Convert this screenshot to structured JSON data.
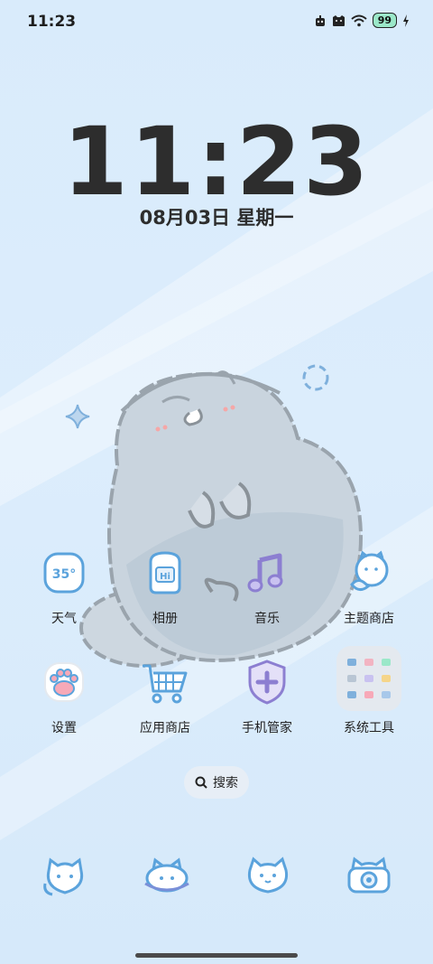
{
  "status_bar": {
    "time": "11:23",
    "battery": "99",
    "icons": [
      "robot-icon",
      "cat-face-icon",
      "wifi-icon",
      "battery-icon",
      "charging-icon"
    ]
  },
  "lock_clock": {
    "time": "11:23",
    "date": "08月03日 星期一"
  },
  "apps": [
    {
      "label": "天气",
      "icon_text": "35°",
      "icon": "weather-icon"
    },
    {
      "label": "相册",
      "icon_text": "Hi",
      "icon": "photo-album-icon"
    },
    {
      "label": "音乐",
      "icon": "music-note-icon"
    },
    {
      "label": "主题商店",
      "icon": "cat-theme-icon"
    },
    {
      "label": "设置",
      "icon": "paw-icon"
    },
    {
      "label": "应用商店",
      "icon": "shopping-cart-icon"
    },
    {
      "label": "手机管家",
      "icon": "shield-plus-icon"
    },
    {
      "label": "系统工具",
      "icon": "folder-icon"
    }
  ],
  "search": {
    "label": "搜索"
  },
  "dock": [
    "cat-phone-icon",
    "cat-message-icon",
    "cat-browser-icon",
    "cat-camera-icon"
  ],
  "colors": {
    "background": "#dcedfc",
    "text": "#2d2d2d",
    "icon_stroke": "#5ba3dc",
    "accent_pink": "#f7a9b8",
    "accent_purple": "#8c7fd1"
  }
}
